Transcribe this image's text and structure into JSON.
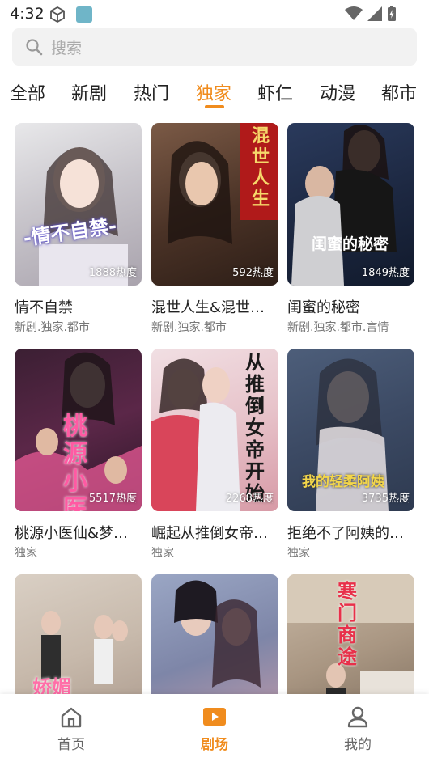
{
  "status": {
    "time": "4:32"
  },
  "search": {
    "placeholder": "搜索"
  },
  "tabs": [
    "全部",
    "新剧",
    "热门",
    "独家",
    "虾仁",
    "动漫",
    "都市"
  ],
  "active_tab_index": 3,
  "accent_color": "#f08c1e",
  "cards": [
    {
      "title": "情不自禁",
      "tags": "新剧.独家.都市",
      "heat": "1888热度",
      "poster_text": "-情不自禁-"
    },
    {
      "title": "混世人生&混世…",
      "tags": "新剧.独家.都市",
      "heat": "592热度",
      "poster_text": "混世人生"
    },
    {
      "title": "闺蜜的秘密",
      "tags": "新剧.独家.都市.言情",
      "heat": "1849热度",
      "poster_text": "闺蜜的秘密"
    },
    {
      "title": "桃源小医仙&梦…",
      "tags": "独家",
      "heat": "5517热度",
      "poster_text": "桃源小医仙"
    },
    {
      "title": "崛起从推倒女帝…",
      "tags": "独家",
      "heat": "2268热度",
      "poster_text": "从推倒女帝开始"
    },
    {
      "title": "拒绝不了阿姨的…",
      "tags": "独家",
      "heat": "3735热度",
      "poster_text": "我的轻柔阿姨"
    },
    {
      "title": "",
      "tags": "",
      "heat": "",
      "poster_text": "娇媚"
    },
    {
      "title": "",
      "tags": "",
      "heat": "",
      "poster_text": ""
    },
    {
      "title": "",
      "tags": "",
      "heat": "",
      "poster_text": "寒门商途"
    }
  ],
  "nav": {
    "home": "首页",
    "theater": "剧场",
    "me": "我的"
  }
}
